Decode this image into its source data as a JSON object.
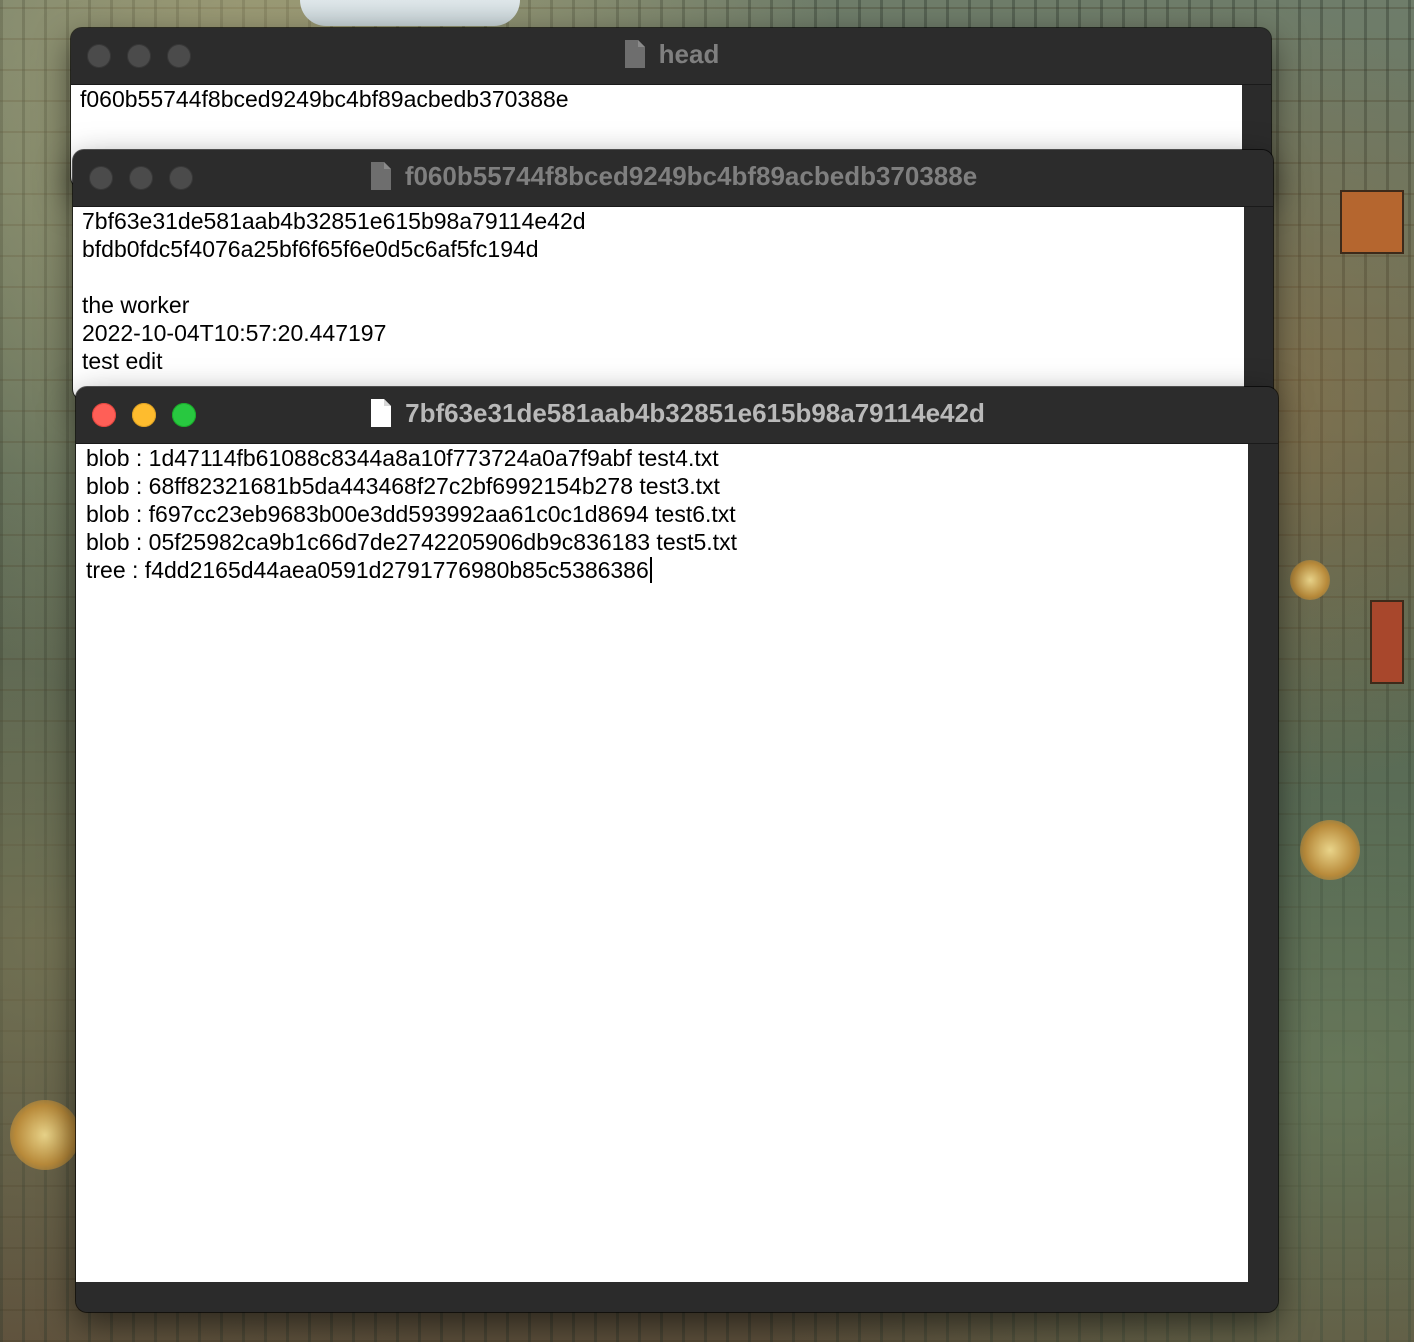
{
  "colors": {
    "window_chrome": "#2c2c2c",
    "content_background": "#ffffff",
    "text": "#000000",
    "title_inactive": "#7f7f7f",
    "title_active": "#b9b9b9",
    "close": "#ff5f57",
    "minimize": "#febc2e",
    "zoom": "#28c840"
  },
  "windows": [
    {
      "title": "head",
      "icon": "document-icon",
      "active": false,
      "lines": [
        "f060b55744f8bced9249bc4bf89acbedb370388e"
      ]
    },
    {
      "title": "f060b55744f8bced9249bc4bf89acbedb370388e",
      "icon": "document-icon",
      "active": false,
      "lines": [
        "7bf63e31de581aab4b32851e615b98a79114e42d",
        "bfdb0fdc5f4076a25bf6f65f6e0d5c6af5fc194d",
        "",
        "the worker",
        "2022-10-04T10:57:20.447197",
        "test edit"
      ]
    },
    {
      "title": "7bf63e31de581aab4b32851e615b98a79114e42d",
      "icon": "document-icon",
      "active": true,
      "lines": [
        "blob : 1d47114fb61088c8344a8a10f773724a0a7f9abf test4.txt",
        "blob : 68ff82321681b5da443468f27c2bf6992154b278 test3.txt",
        "blob : f697cc23eb9683b00e3dd593992aa61c0c1d8694 test6.txt",
        "blob : 05f25982ca9b1c66d7de2742205906db9c836183 test5.txt",
        "tree : f4dd2165d44aea0591d2791776980b85c5386386"
      ]
    }
  ]
}
